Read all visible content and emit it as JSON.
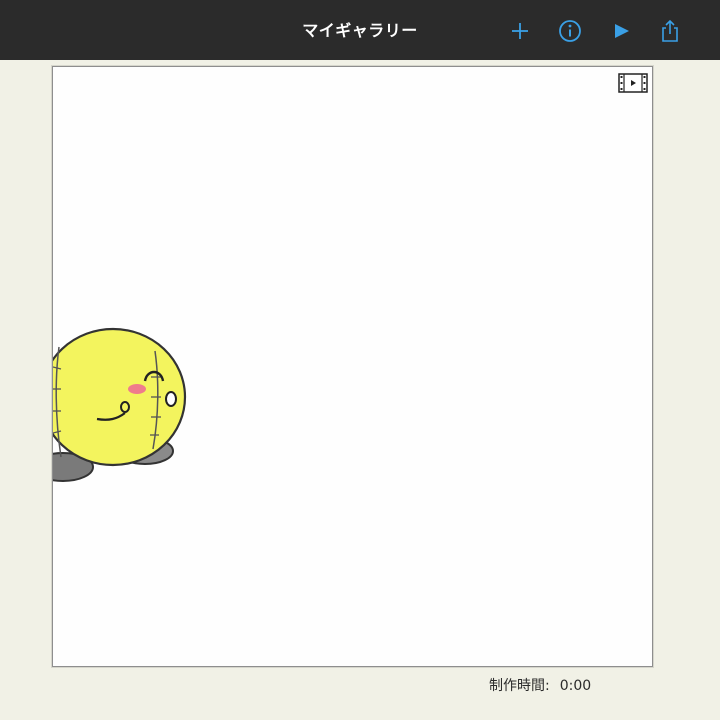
{
  "nav": {
    "title": "マイギャラリー",
    "buttons": [
      {
        "icon": "plus-icon"
      },
      {
        "icon": "info-icon"
      },
      {
        "icon": "play-icon"
      },
      {
        "icon": "share-icon"
      }
    ],
    "accent_color": "#3aa0e6",
    "background_color": "#2b2b2b"
  },
  "canvas": {
    "badge_icon": "video-film-icon",
    "artwork_icon": "yellow-ball-character-illustration"
  },
  "footer": {
    "time_label": "制作時間:",
    "time_value": "0:00"
  }
}
